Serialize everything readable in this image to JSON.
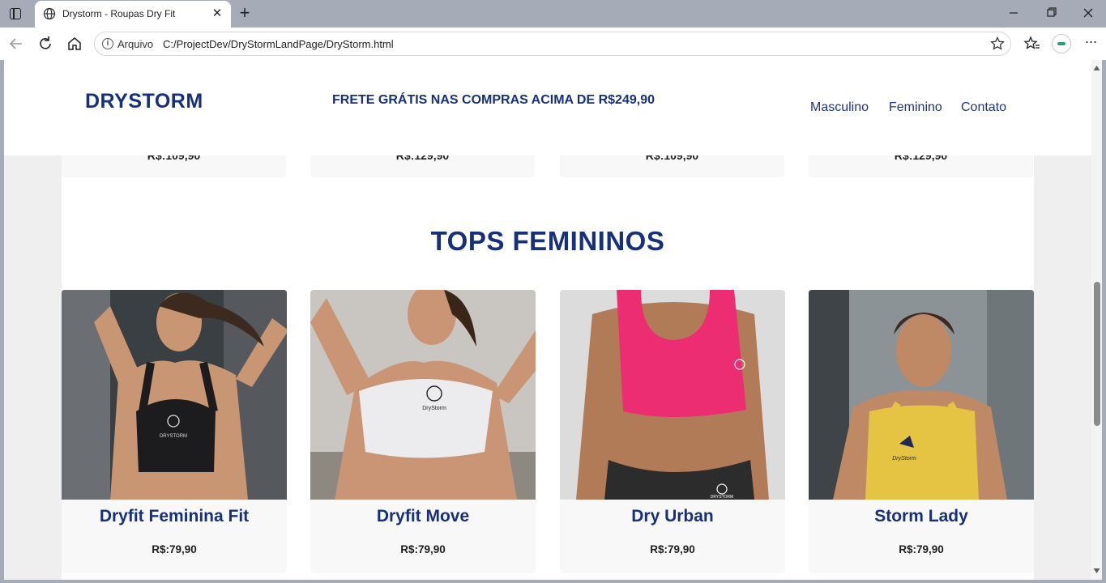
{
  "browser": {
    "tab_title": "Drystorm - Roupas Dry Fit",
    "address_scheme": "Arquivo",
    "address_url": "C:/ProjectDev/DryStormLandPage/DryStorm.html"
  },
  "header": {
    "logo": "DRYSTORM",
    "promo": "FRETE GRÁTIS NAS COMPRAS ACIMA DE R$249,90",
    "nav": [
      "Masculino",
      "Feminino",
      "Contato"
    ]
  },
  "previous_row": {
    "prices": [
      "R$:109,90",
      "R$:129,90",
      "R$:109,90",
      "R$:129,90"
    ]
  },
  "section": {
    "title": "TOPS FEMININOS",
    "products": [
      {
        "name": "Dryfit Feminina Fit",
        "price": "R$:79,90",
        "top_color": "#1c1c1e",
        "logo_text": "DRYSTORM"
      },
      {
        "name": "Dryfit Move",
        "price": "R$:79,90",
        "top_color": "#ececef",
        "logo_text": "DryStorm"
      },
      {
        "name": "Dry Urban",
        "price": "R$:79,90",
        "top_color": "#ec2d72",
        "logo_text": "DRYSTORM"
      },
      {
        "name": "Storm Lady",
        "price": "R$:79,90",
        "top_color": "#e5c443",
        "logo_text": "DryStorm"
      }
    ]
  },
  "colors": {
    "brand_navy": "#16307a",
    "page_bg": "#efefef",
    "card_bg": "#f8f8f8"
  }
}
